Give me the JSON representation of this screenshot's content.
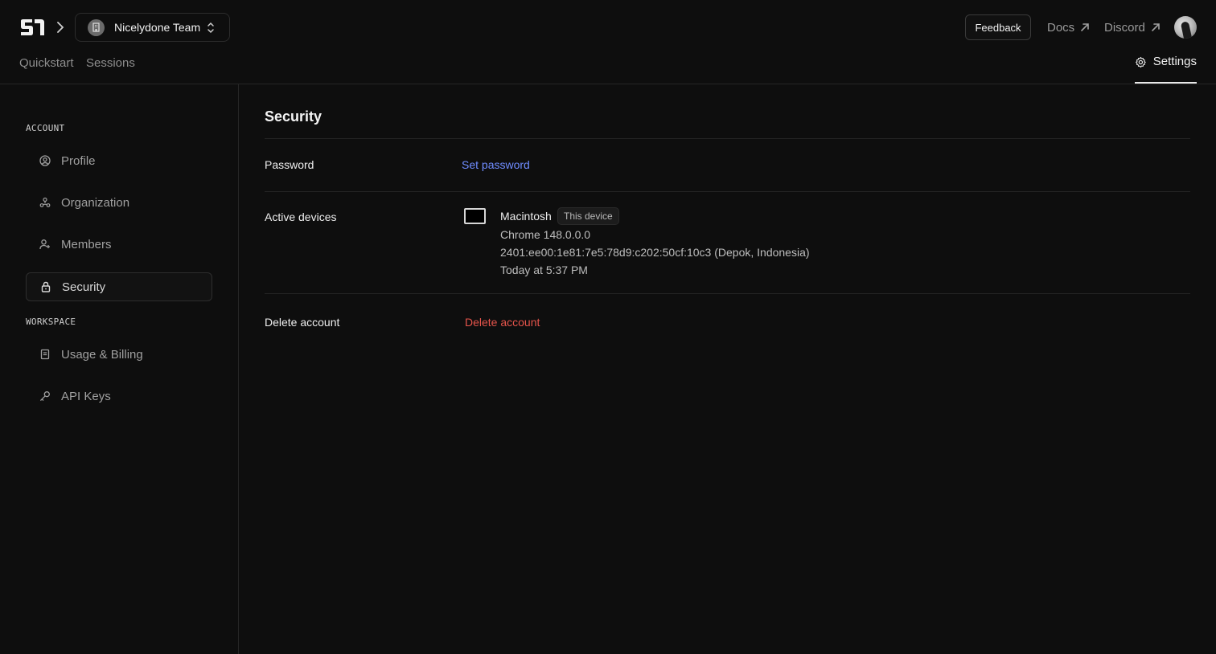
{
  "header": {
    "team_name": "Nicelydone Team",
    "feedback_label": "Feedback",
    "docs_label": "Docs",
    "discord_label": "Discord",
    "tabs": [
      {
        "label": "Quickstart"
      },
      {
        "label": "Sessions"
      }
    ],
    "settings_label": "Settings"
  },
  "sidebar": {
    "account_heading": "ACCOUNT",
    "workspace_heading": "WORKSPACE",
    "items": [
      {
        "label": "Profile",
        "icon": "user-circle-icon"
      },
      {
        "label": "Organization",
        "icon": "organization-icon"
      },
      {
        "label": "Members",
        "icon": "user-plus-icon"
      },
      {
        "label": "Security",
        "icon": "lock-icon"
      },
      {
        "label": "Usage & Billing",
        "icon": "receipt-icon"
      },
      {
        "label": "API Keys",
        "icon": "key-icon"
      }
    ]
  },
  "main": {
    "title": "Security",
    "password_label": "Password",
    "set_password_label": "Set password",
    "active_devices_label": "Active devices",
    "device": {
      "name": "Macintosh",
      "badge": "This device",
      "browser": "Chrome 148.0.0.0",
      "ip_location": "2401:ee00:1e81:7e5:78d9:c202:50cf:10c3 (Depok, Indonesia)",
      "last_active": "Today at 5:37 PM"
    },
    "delete_account_label": "Delete account",
    "delete_account_action": "Delete account"
  },
  "colors": {
    "background": "#0e0e0e",
    "link_blue": "#6f8cff",
    "danger_red": "#e5544b",
    "border": "#262626"
  }
}
